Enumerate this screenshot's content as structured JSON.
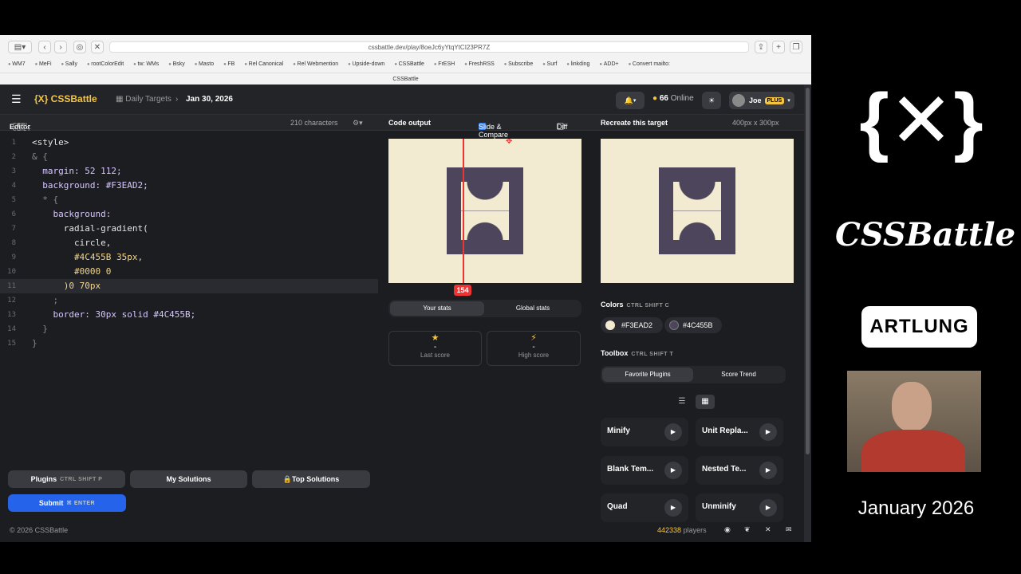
{
  "browser": {
    "url": "cssbattle.dev/play/8oeJc6yYtqYtCI23PR7Z",
    "tab": "CSSBattle",
    "bookmarks": [
      "WM7",
      "MeFi",
      "Sally",
      "rootColorEdit",
      "tw: WMs",
      "Bsky",
      "Masto",
      "FB",
      "Rel Canonical",
      "Rel Webmention",
      "Upside-down",
      "CSSBattle",
      "FrESH",
      "FreshRSS",
      "Subscribe",
      "Surf",
      "linkding",
      "ADD+",
      "Convert mailto:"
    ]
  },
  "header": {
    "logo": "{X} CSSBattle",
    "daily": "Daily Targets",
    "date": "Jan 30, 2026",
    "online_count": "66",
    "online_label": "Online",
    "user": "Joe",
    "plus": "PLUS"
  },
  "editor": {
    "title": "Editor",
    "shortcut": "CTRL SHIFT E",
    "chars": "210 characters",
    "lines": [
      {
        "n": "1",
        "t": "<style>"
      },
      {
        "n": "2",
        "t": "& {"
      },
      {
        "n": "3",
        "t": "  margin: 52 112;"
      },
      {
        "n": "4",
        "t": "  background: #F3EAD2;"
      },
      {
        "n": "5",
        "t": "  * {"
      },
      {
        "n": "6",
        "t": "    background:"
      },
      {
        "n": "7",
        "t": "      radial-gradient("
      },
      {
        "n": "8",
        "t": "        circle,"
      },
      {
        "n": "9",
        "t": "        #4C455B 35px,"
      },
      {
        "n": "10",
        "t": "        #0000 0"
      },
      {
        "n": "11",
        "t": "      )0 70px"
      },
      {
        "n": "12",
        "t": "    ;"
      },
      {
        "n": "13",
        "t": "    border: 30px solid #4C455B;"
      },
      {
        "n": "14",
        "t": "  }"
      },
      {
        "n": "15",
        "t": "}"
      }
    ]
  },
  "output": {
    "title": "Code output",
    "slide_compare": "Slide & Compare",
    "diff": "Diff",
    "slider_value": "154"
  },
  "target": {
    "title": "Recreate this target",
    "size": "400px x 300px"
  },
  "stats": {
    "your": "Your stats",
    "global": "Global stats",
    "last_value": "-",
    "last_label": "Last score",
    "high_value": "-",
    "high_label": "High score"
  },
  "colors": {
    "title": "Colors",
    "shortcut": "CTRL SHIFT C",
    "c1": "#F3EAD2",
    "c2": "#4C455B"
  },
  "toolbox": {
    "title": "Toolbox",
    "shortcut": "CTRL SHIFT T",
    "tab1": "Favorite Plugins",
    "tab2": "Score Trend",
    "plugins": [
      "Minify",
      "Unit Repla...",
      "Blank Tem...",
      "Nested Te...",
      "Quad",
      "Unminify"
    ]
  },
  "bottom": {
    "plugins": "Plugins",
    "plugins_kbd": "CTRL SHIFT P",
    "my_solutions": "My Solutions",
    "top_solutions": "Top Solutions",
    "submit": "Submit",
    "submit_kbd": "⌘ ENTER"
  },
  "footer": {
    "copyright": "© 2026 CSSBattle",
    "players_count": "442338",
    "players_label": "players"
  },
  "overlay": {
    "month": "January 2026",
    "brand": "ARTLUNG",
    "logo_text": "CSSBattle"
  }
}
